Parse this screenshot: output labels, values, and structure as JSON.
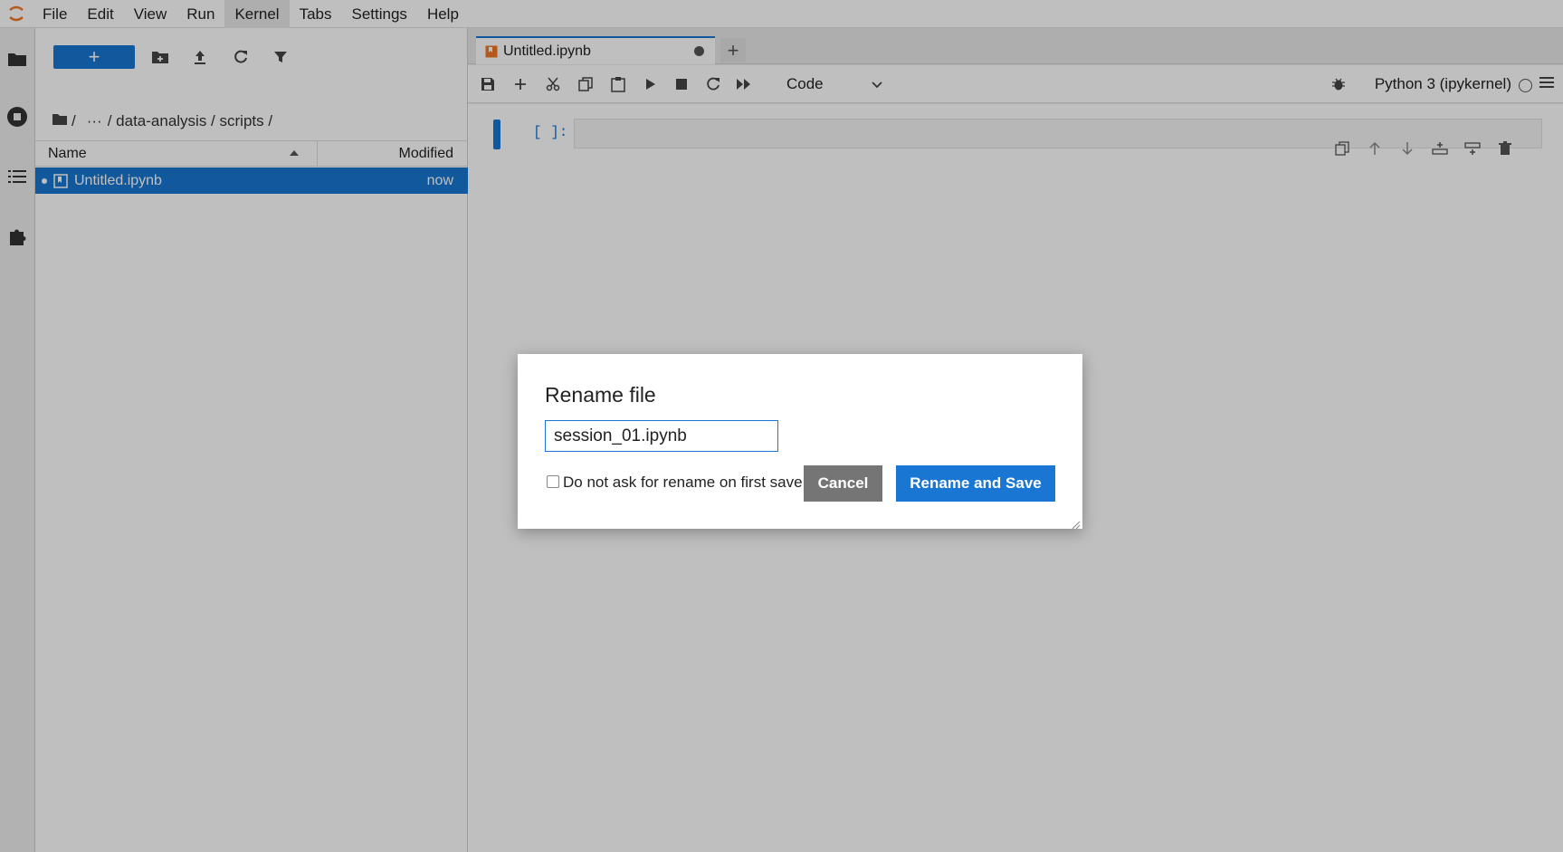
{
  "menubar": {
    "items": [
      "File",
      "Edit",
      "View",
      "Run",
      "Kernel",
      "Tabs",
      "Settings",
      "Help"
    ],
    "active": "Kernel"
  },
  "activity": {
    "icons": [
      "folder-icon",
      "running-icon",
      "toc-icon",
      "extension-icon"
    ]
  },
  "filebrowser": {
    "new_label": "+",
    "breadcrumbs": [
      "/",
      "···",
      "/ data-analysis / scripts /"
    ],
    "columns": {
      "name": "Name",
      "modified": "Modified"
    },
    "rows": [
      {
        "name": "Untitled.ipynb",
        "modified": "now"
      }
    ]
  },
  "tabs": [
    {
      "label": "Untitled.ipynb"
    }
  ],
  "tab_add_label": "+",
  "notebook": {
    "cell_type": "Code",
    "kernel": "Python 3 (ipykernel)",
    "prompt": "[ ]:"
  },
  "dialog": {
    "title": "Rename file",
    "input_value": "session_01.ipynb",
    "checkbox_label": "Do not ask for rename on first save.",
    "cancel_label": "Cancel",
    "save_label": "Rename and Save"
  },
  "colors": {
    "accent": "#1976d2",
    "cancel": "#757575",
    "logo": "#f37626"
  }
}
